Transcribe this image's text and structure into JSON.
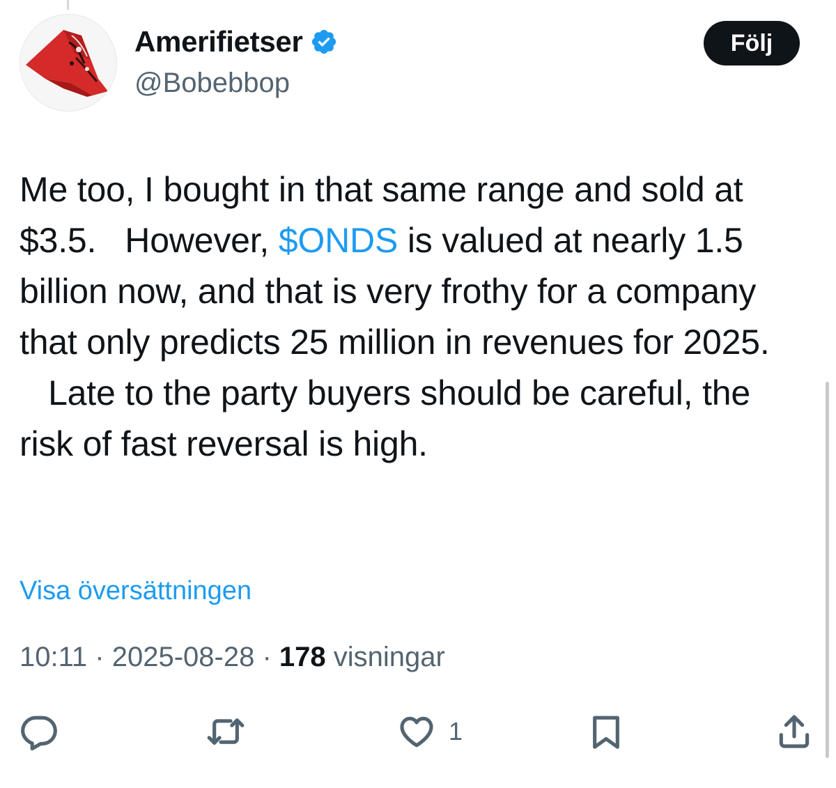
{
  "author": {
    "display_name": "Amerifietser",
    "handle": "@Bobebbop",
    "verified": true,
    "avatar_icon": "red-bandana-avatar",
    "verified_color": "#1d9bf0"
  },
  "follow_button": {
    "label": "Följ"
  },
  "tweet": {
    "part1": "Me too, I bought in that same range and sold at $3.5.",
    "part2": "However,",
    "cashtag": "$ONDS",
    "part3": "is valued at nearly 1.5 billion now, and that is very frothy for a company that only predicts 25 million in revenues for 2025.",
    "part4": "Late to the party buyers should be careful, the risk of fast reversal is high."
  },
  "translate": {
    "label": "Visa översättningen"
  },
  "meta": {
    "time": "10:11",
    "separator": "·",
    "date": "2025-08-28",
    "views_count": "178",
    "views_label": "visningar"
  },
  "actions": {
    "reply_icon": "reply-icon",
    "retweet_icon": "retweet-icon",
    "like_icon": "heart-icon",
    "like_count": "1",
    "bookmark_icon": "bookmark-icon",
    "share_icon": "share-icon"
  },
  "colors": {
    "text": "#0f1419",
    "secondary": "#536471",
    "link": "#1d9bf0",
    "button_bg": "#0f1419"
  }
}
